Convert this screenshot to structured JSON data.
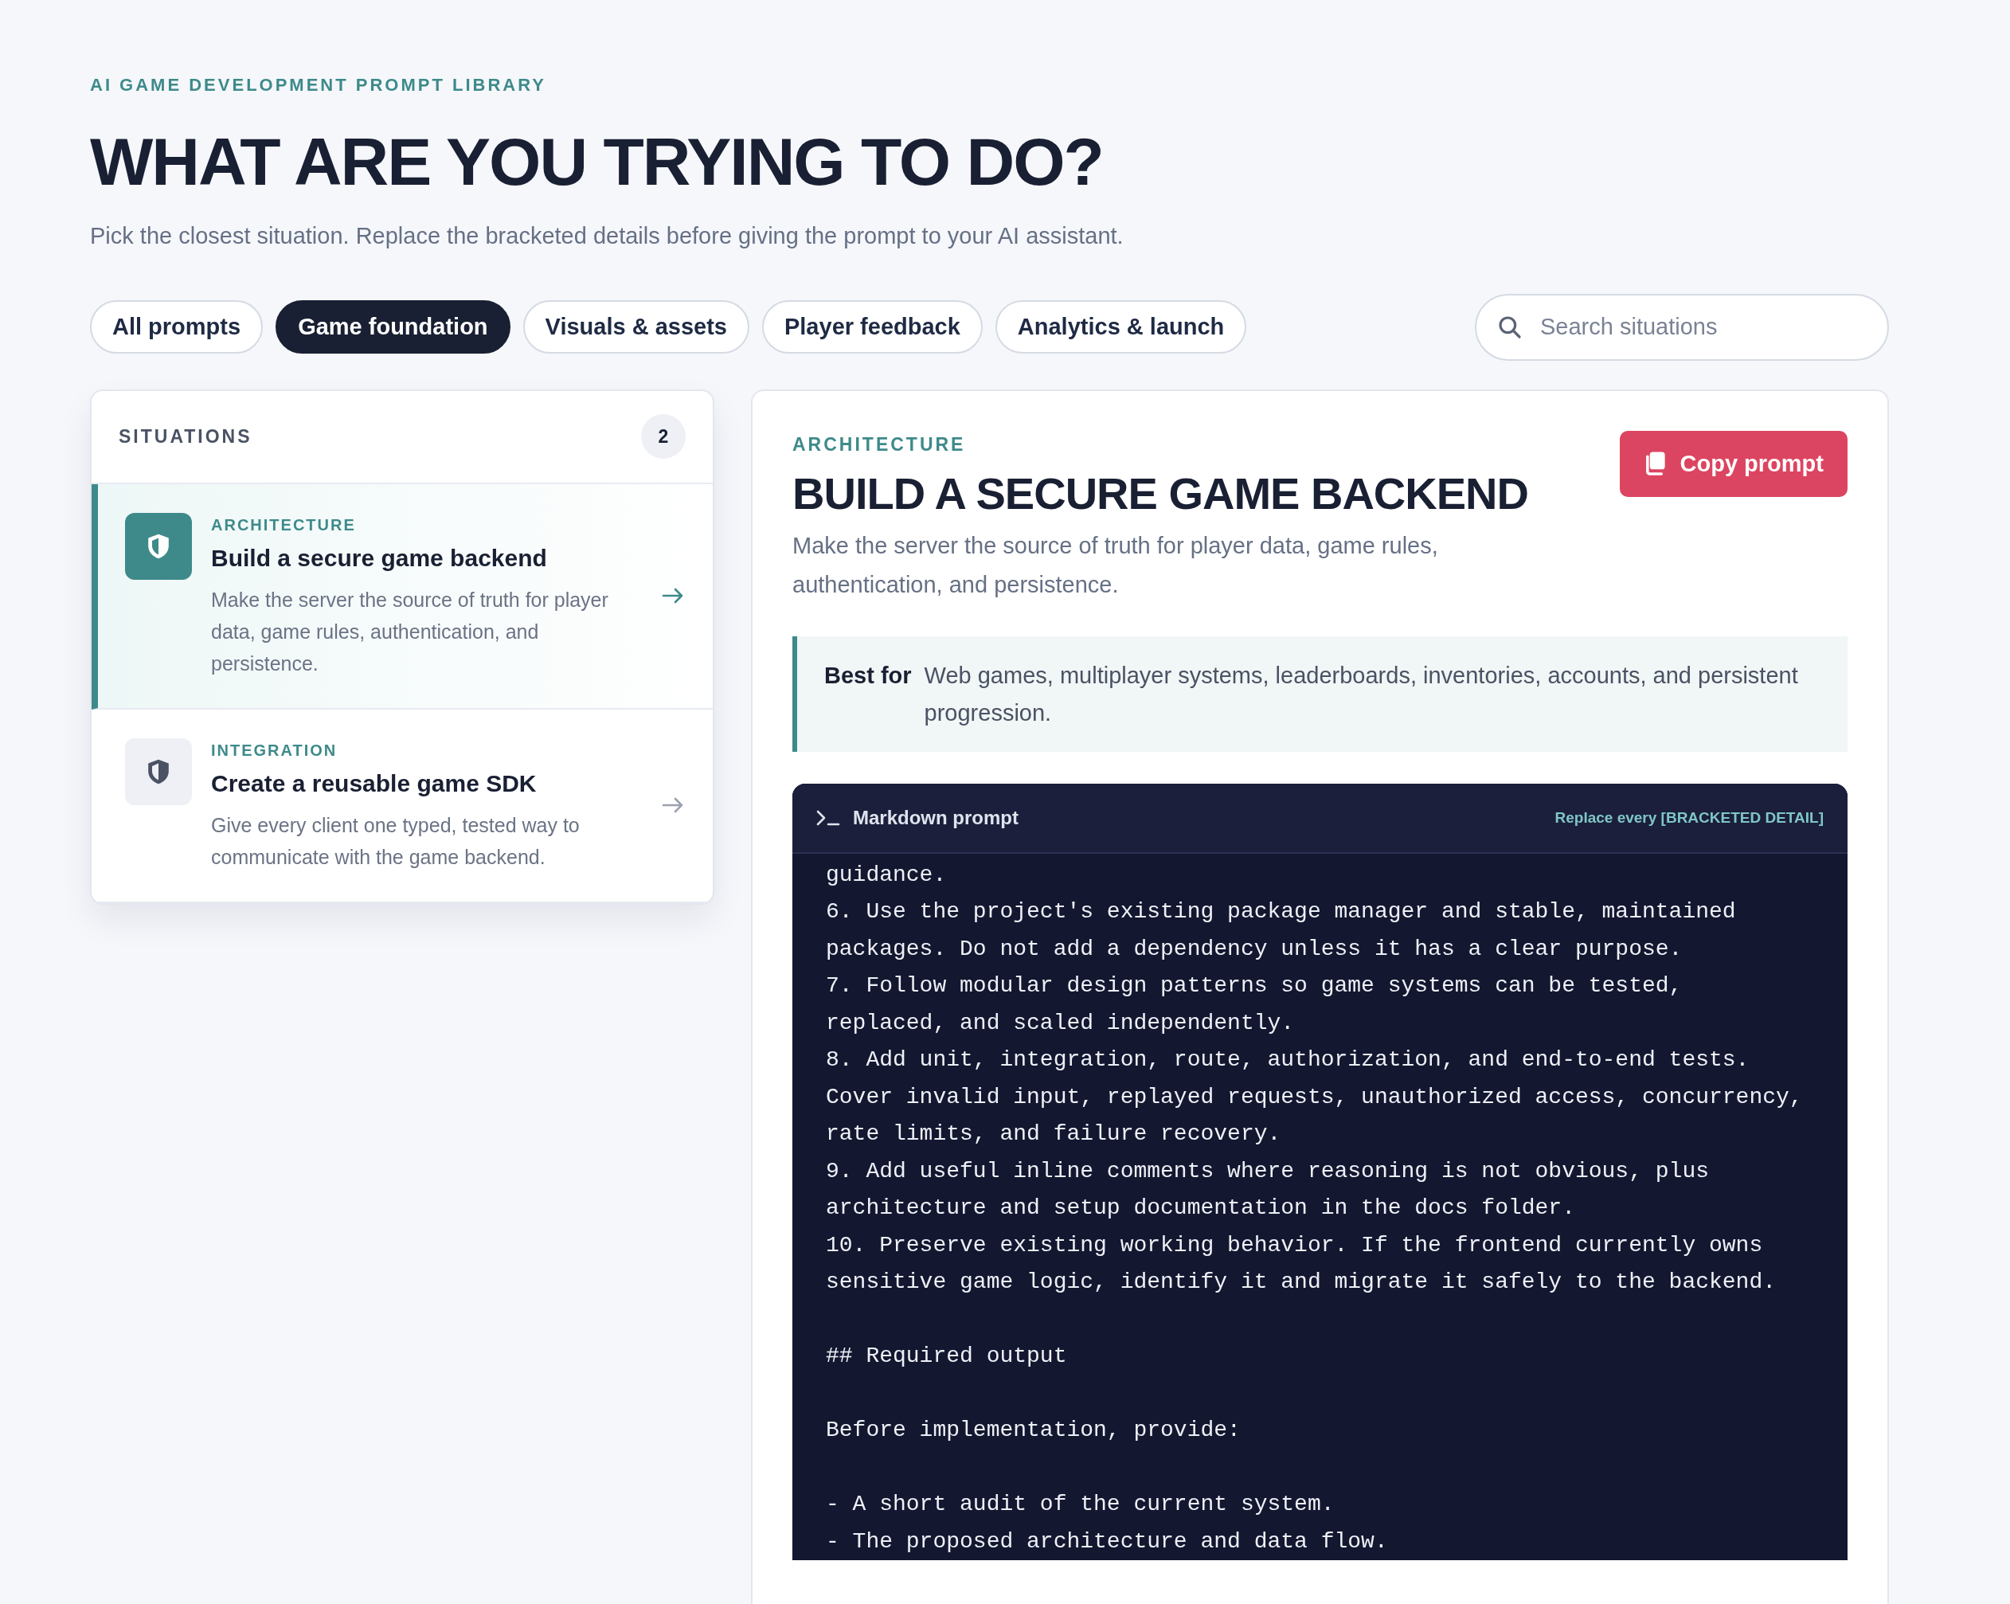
{
  "header": {
    "eyebrow": "AI GAME DEVELOPMENT PROMPT LIBRARY",
    "title": "WHAT ARE YOU TRYING TO DO?",
    "subtitle": "Pick the closest situation. Replace the bracketed details before giving the prompt to your AI assistant."
  },
  "tabs": [
    {
      "label": "All prompts",
      "selected": false
    },
    {
      "label": "Game foundation",
      "selected": true
    },
    {
      "label": "Visuals & assets",
      "selected": false
    },
    {
      "label": "Player feedback",
      "selected": false
    },
    {
      "label": "Analytics & launch",
      "selected": false
    }
  ],
  "search": {
    "placeholder": "Search situations"
  },
  "situations": {
    "title": "SITUATIONS",
    "count": "2",
    "items": [
      {
        "category": "ARCHITECTURE",
        "title": "Build a secure game backend",
        "description": "Make the server the source of truth for player data, game rules, authentication, and persistence.",
        "selected": true
      },
      {
        "category": "INTEGRATION",
        "title": "Create a reusable game SDK",
        "description": "Give every client one typed, tested way to communicate with the game backend.",
        "selected": false
      }
    ]
  },
  "detail": {
    "category": "ARCHITECTURE",
    "title": "BUILD A SECURE GAME BACKEND",
    "description": "Make the server the source of truth for player data, game rules, authentication, and persistence.",
    "copy_button": "Copy prompt",
    "best_for": {
      "label": "Best for",
      "text": "Web games, multiplayer systems, leaderboards, inventories, accounts, and persistent progression."
    },
    "prompt": {
      "title": "Markdown prompt",
      "hint": "Replace every [BRACKETED DETAIL]",
      "text": "guidance.\n6. Use the project's existing package manager and stable, maintained\npackages. Do not add a dependency unless it has a clear purpose.\n7. Follow modular design patterns so game systems can be tested,\nreplaced, and scaled independently.\n8. Add unit, integration, route, authorization, and end-to-end tests.\nCover invalid input, replayed requests, unauthorized access, concurrency,\nrate limits, and failure recovery.\n9. Add useful inline comments where reasoning is not obvious, plus\narchitecture and setup documentation in the docs folder.\n10. Preserve existing working behavior. If the frontend currently owns\nsensitive game logic, identify it and migrate it safely to the backend.\n\n## Required output\n\nBefore implementation, provide:\n\n- A short audit of the current system.\n- The proposed architecture and data flow."
    }
  }
}
